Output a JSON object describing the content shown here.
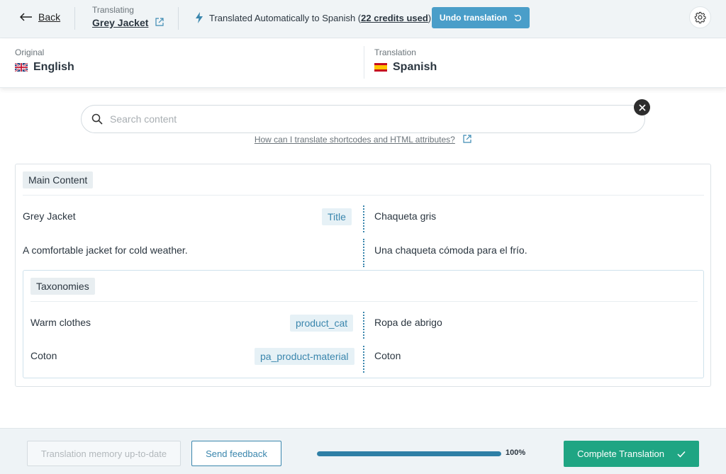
{
  "header": {
    "back_label": "Back",
    "translating_label": "Translating",
    "product_name": "Grey Jacket",
    "auto_text": "Translated Automatically to Spanish (",
    "credits_text": "22 credits used",
    "auto_text_end": ")",
    "undo_label": "Undo translation"
  },
  "languages": {
    "original_label": "Original",
    "original_value": "English",
    "translation_label": "Translation",
    "translation_value": "Spanish"
  },
  "search": {
    "placeholder": "Search content",
    "help_link": "How can I translate shortcodes and HTML attributes?"
  },
  "main": {
    "section_label": "Main Content",
    "rows": [
      {
        "source": "Grey Jacket",
        "field": "Title",
        "target": "Chaqueta gris"
      },
      {
        "source": "A comfortable jacket for cold weather.",
        "field": "",
        "target": "Una chaqueta cómoda para el frío."
      }
    ]
  },
  "taxonomies": {
    "section_label": "Taxonomies",
    "rows": [
      {
        "source": "Warm clothes",
        "field": "product_cat",
        "target": "Ropa de abrigo"
      },
      {
        "source": "Coton",
        "field": "pa_product-material",
        "target": "Coton"
      }
    ]
  },
  "footer": {
    "memory_label": "Translation memory up-to-date",
    "feedback_label": "Send feedback",
    "progress": 100,
    "progress_text": "100%",
    "complete_label": "Complete Translation"
  },
  "colors": {
    "accent": "#4a9ec9",
    "link": "#3a86ad",
    "success": "#1fa583"
  }
}
